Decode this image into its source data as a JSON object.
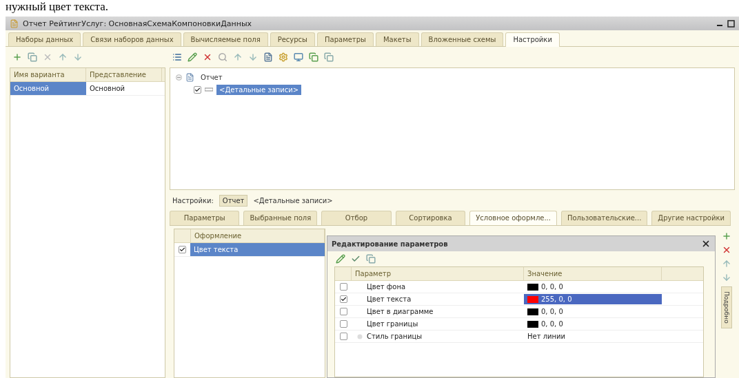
{
  "caption": "нужный цвет текста.",
  "window": {
    "title": "Отчет РейтингУслуг: ОсновнаяСхемаКомпоновкиДанных"
  },
  "tabs": [
    {
      "label": "Наборы данных",
      "selected": false
    },
    {
      "label": "Связи наборов данных",
      "selected": false
    },
    {
      "label": "Вычисляемые поля",
      "selected": false
    },
    {
      "label": "Ресурсы",
      "selected": false
    },
    {
      "label": "Параметры",
      "selected": false
    },
    {
      "label": "Макеты",
      "selected": false
    },
    {
      "label": "Вложенные схемы",
      "selected": false
    },
    {
      "label": "Настройки",
      "selected": true
    }
  ],
  "variants": {
    "columns": [
      "Имя варианта",
      "Представление"
    ],
    "rows": [
      {
        "name": "Основной",
        "presentation": "Основной",
        "selected": true
      }
    ]
  },
  "tree": {
    "label": "Отчет",
    "children": [
      {
        "label": "<Детальные записи>",
        "checked": true,
        "selected": true
      }
    ]
  },
  "settings_bar": {
    "label": "Настройки:",
    "items": [
      {
        "label": "Отчет",
        "selected": true
      },
      {
        "label": "<Детальные записи>",
        "selected": false
      }
    ]
  },
  "subtabs": [
    {
      "label": "Параметры",
      "selected": false
    },
    {
      "label": "Выбранные поля",
      "selected": false
    },
    {
      "label": "Отбор",
      "selected": false
    },
    {
      "label": "Сортировка",
      "selected": false
    },
    {
      "label": "Условное оформле...",
      "selected": true
    },
    {
      "label": "Пользовательские...",
      "selected": false
    },
    {
      "label": "Другие настройки",
      "selected": false
    }
  ],
  "appearance": {
    "column": "Оформление",
    "rows": [
      {
        "label": "Цвет текста",
        "checked": true,
        "selected": true
      }
    ]
  },
  "dialog": {
    "title": "Редактирование параметров",
    "columns": [
      "Параметр",
      "Значение"
    ],
    "rows": [
      {
        "name": "Цвет фона",
        "checked": false,
        "kind": "color",
        "color": "#000000",
        "value": "0, 0, 0",
        "selected": false
      },
      {
        "name": "Цвет текста",
        "checked": true,
        "kind": "color",
        "color": "#ff0000",
        "value": "255, 0, 0",
        "selected": true
      },
      {
        "name": "Цвет в диаграмме",
        "checked": false,
        "kind": "color",
        "color": "#000000",
        "value": "0, 0, 0",
        "selected": false
      },
      {
        "name": "Цвет границы",
        "checked": false,
        "kind": "color",
        "color": "#000000",
        "value": "0, 0, 0",
        "selected": false
      },
      {
        "name": "Стиль границы",
        "checked": false,
        "kind": "group",
        "value": "Нет линии",
        "selected": false
      }
    ]
  },
  "side_tab": "Подробно"
}
